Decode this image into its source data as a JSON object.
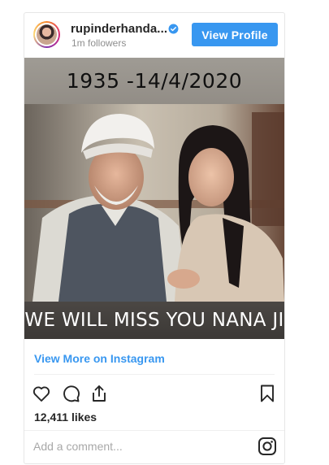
{
  "post": {
    "username": "rupinderhanda...",
    "followers": "1m followers",
    "view_profile_label": "View Profile",
    "banner_top": "1935 -14/4/2020",
    "banner_bottom": "WE WILL MISS YOU NANA JI",
    "view_more_label": "View More on Instagram",
    "likes": "12,411 likes",
    "comment_placeholder": "Add a comment..."
  },
  "colors": {
    "accent": "#3897f0",
    "text": "#262626",
    "muted": "#8e8e8e"
  },
  "icons": [
    "verified-badge-icon",
    "heart-icon",
    "comment-icon",
    "share-icon",
    "bookmark-icon",
    "instagram-icon"
  ]
}
